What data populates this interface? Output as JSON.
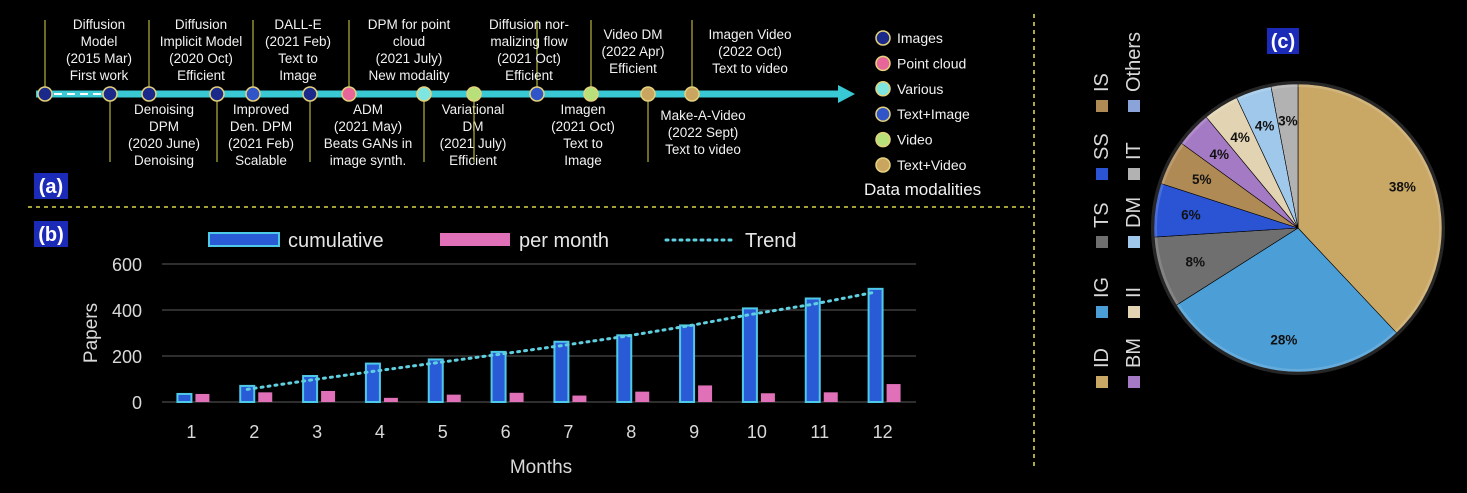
{
  "panel_labels": {
    "a": "(a)",
    "b": "(b)",
    "c": "(c)"
  },
  "colors": {
    "background": "#000000",
    "divider": "#d8d84a",
    "timeline_arrow": "#38c9d4",
    "images": "#1b2a8a",
    "point_cloud": "#e8659a",
    "various": "#7ee6e0",
    "text_image": "#2f55c8",
    "video": "#b8e07a",
    "text_video": "#caa560",
    "node_ring": "#e5d27c",
    "cumulative_bar": "#2a5bd7",
    "cumulative_edge": "#4fc9e8",
    "per_month_bar": "#e070b8",
    "trend": "#5fd0e0"
  },
  "timeline": {
    "top_events": [
      {
        "lines": [
          "Diffusion",
          "Model",
          "(2015 Mar)",
          "First work"
        ],
        "modality": "images"
      },
      {
        "lines": [
          "Diffusion",
          "Implicit Model",
          "(2020 Oct)",
          "Efficient"
        ],
        "modality": "images"
      },
      {
        "lines": [
          "DALL-E",
          "(2021 Feb)",
          "Text to",
          "Image"
        ],
        "modality": "text_image"
      },
      {
        "lines": [
          "DPM for point",
          "cloud",
          "(2021 July)",
          "New modality"
        ],
        "modality": "point_cloud"
      },
      {
        "lines": [
          "Diffusion nor-",
          "malizing flow",
          "(2021 Oct)",
          "Efficient"
        ],
        "modality": "text_image"
      },
      {
        "lines": [
          "Video DM",
          "(2022 Apr)",
          "Efficient"
        ],
        "modality": "video"
      },
      {
        "lines": [
          "Imagen Video",
          "(2022 Oct)",
          "Text to video"
        ],
        "modality": "text_video"
      }
    ],
    "bottom_events": [
      {
        "lines": [
          "Denoising",
          "DPM",
          "(2020 June)",
          "Denoising"
        ],
        "modality": "images"
      },
      {
        "lines": [
          "Improved",
          "Den. DPM",
          "(2021 Feb)",
          "Scalable"
        ],
        "modality": "images"
      },
      {
        "lines": [
          "ADM",
          "(2021 May)",
          "Beats GANs in",
          "image synth."
        ],
        "modality": "images"
      },
      {
        "lines": [
          "Variational",
          "DM",
          "(2021 July)",
          "Efficient"
        ],
        "modality": "various"
      },
      {
        "lines": [
          "Imagen",
          "(2021 Oct)",
          "Text to",
          "Image"
        ],
        "modality": "video"
      },
      {
        "lines": [
          "Make-A-Video",
          "(2022 Sept)",
          "Text to video"
        ],
        "modality": "text_video"
      }
    ]
  },
  "modalities_legend": {
    "title": "Data modalities",
    "items": [
      {
        "key": "images",
        "label": "Images"
      },
      {
        "key": "point_cloud",
        "label": "Point cloud"
      },
      {
        "key": "various",
        "label": "Various"
      },
      {
        "key": "text_image",
        "label": "Text+Image"
      },
      {
        "key": "video",
        "label": "Video"
      },
      {
        "key": "text_video",
        "label": "Text+Video"
      }
    ]
  },
  "chart_data": [
    {
      "type": "bar",
      "title": "",
      "xlabel": "Months",
      "ylabel": "Papers",
      "categories": [
        "1",
        "2",
        "3",
        "4",
        "5",
        "6",
        "7",
        "8",
        "9",
        "10",
        "11",
        "12"
      ],
      "ylim": [
        0,
        600
      ],
      "yticks": [
        "0",
        "200",
        "400",
        "600"
      ],
      "grid": true,
      "legend_position": "top",
      "series": [
        {
          "name": "cumulative",
          "values": [
            35,
            70,
            113,
            167,
            185,
            218,
            262,
            290,
            333,
            407,
            450,
            492
          ]
        },
        {
          "name": "per month",
          "values": [
            35,
            42,
            48,
            18,
            32,
            40,
            28,
            45,
            72,
            38,
            42,
            78
          ]
        }
      ],
      "trend": {
        "name": "Trend",
        "values": [
          null,
          55,
          95,
          133,
          170,
          207,
          245,
          285,
          330,
          380,
          425,
          478
        ]
      }
    },
    {
      "type": "pie",
      "title": "",
      "slices": [
        {
          "label": "ID",
          "value": 38,
          "display": "38%",
          "color": "#c9a866"
        },
        {
          "label": "IG",
          "value": 28,
          "display": "28%",
          "color": "#4b9ed6"
        },
        {
          "label": "TS",
          "value": 8,
          "display": "8%",
          "color": "#6f6f6f"
        },
        {
          "label": "SS",
          "value": 6,
          "display": "6%",
          "color": "#2a54d4"
        },
        {
          "label": "IS",
          "value": 5,
          "display": "5%",
          "color": "#b08a55"
        },
        {
          "label": "BM",
          "value": 4,
          "display": "4%",
          "color": "#a57ac4"
        },
        {
          "label": "II",
          "value": 4,
          "display": "4%",
          "color": "#e2d4b2"
        },
        {
          "label": "DM",
          "value": 4,
          "display": "4%",
          "color": "#9fc8ea"
        },
        {
          "label": "IT",
          "value": 3,
          "display": "3%",
          "color": "#b2b2b2"
        },
        {
          "label": "Others",
          "value": 0,
          "display": "",
          "color": "#8aa3d8"
        }
      ],
      "legend_position": "left (rotated)",
      "legend_order": [
        "ID",
        "IG",
        "TS",
        "SS",
        "IS",
        "BM",
        "II",
        "DM",
        "IT",
        "Others"
      ]
    }
  ]
}
